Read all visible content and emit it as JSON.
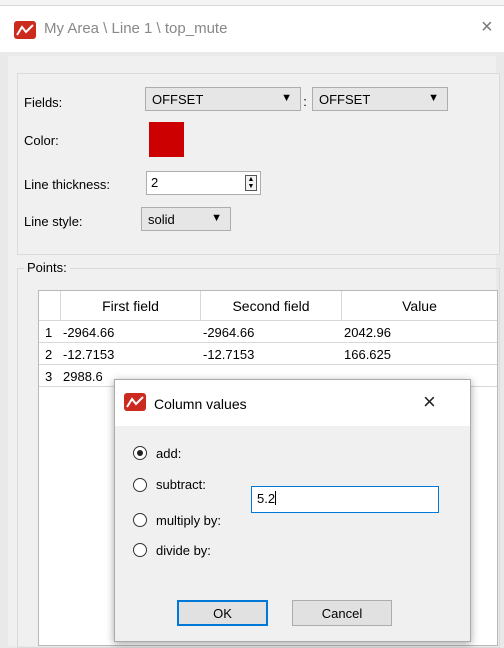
{
  "window": {
    "title": "My Area \\ Line 1 \\ top_mute",
    "close_glyph": "×"
  },
  "properties": {
    "fields_label": "Fields:",
    "field1": "OFFSET",
    "separator": ":",
    "field2": "OFFSET",
    "color_label": "Color:",
    "color_value": "#cc0000",
    "thickness_label": "Line thickness:",
    "thickness_value": "2",
    "style_label": "Line style:",
    "style_value": "solid"
  },
  "points": {
    "group_title": "Points:",
    "columns": [
      "First field",
      "Second field",
      "Value"
    ],
    "rows": [
      {
        "num": "1",
        "first": "-2964.66",
        "second": "-2964.66",
        "value": "2042.96"
      },
      {
        "num": "2",
        "first": "-12.7153",
        "second": "-12.7153",
        "value": "166.625"
      },
      {
        "num": "3",
        "first": "2988.6",
        "second": "",
        "value": ""
      }
    ]
  },
  "dialog": {
    "title": "Column values",
    "close_glyph": "×",
    "options": [
      "add:",
      "subtract:",
      "multiply by:",
      "divide by:"
    ],
    "selected_option": "add:",
    "input_value": "5.2",
    "ok_label": "OK",
    "cancel_label": "Cancel"
  },
  "icons": {
    "app": "app-logo-icon",
    "dropdown": "chevron-down-icon",
    "spin": "spin-arrows-icon"
  },
  "colors": {
    "accent": "#0078d7",
    "brand": "#cc2a1e",
    "swatch": "#cc0000"
  }
}
